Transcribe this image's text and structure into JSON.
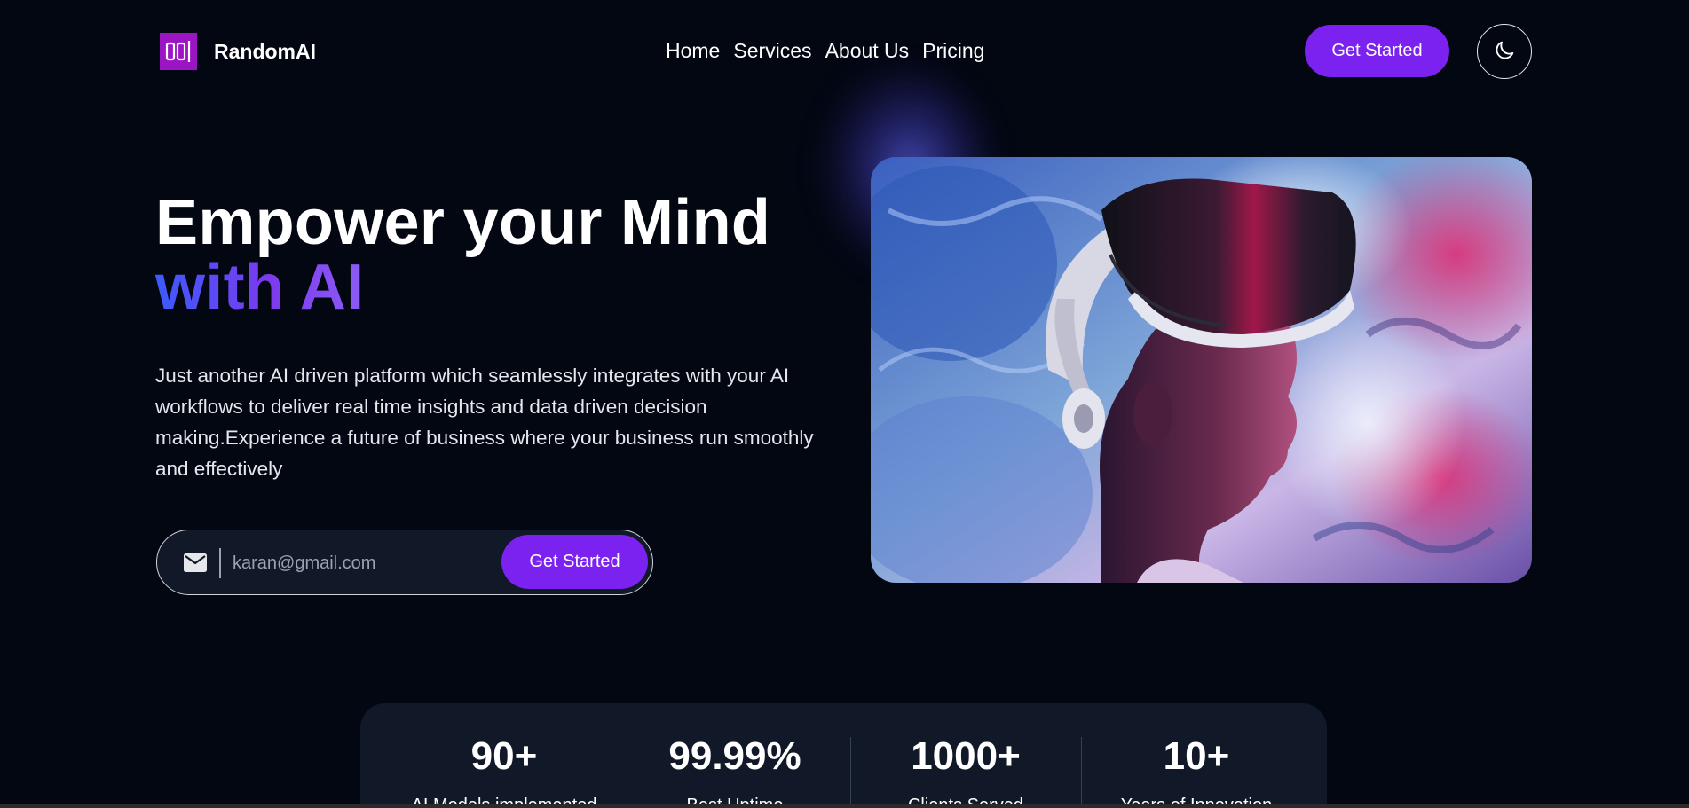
{
  "brand": {
    "name": "RandomAI",
    "logo_icon": "brackets-logo-icon",
    "logo_color": "#9b15c4"
  },
  "nav": {
    "items": [
      "Home",
      "Services",
      "About Us",
      "Pricing"
    ]
  },
  "header": {
    "cta_label": "Get Started",
    "theme_icon": "moon-icon"
  },
  "hero": {
    "title_line1": "Empower your Mind",
    "title_line2": "with AI",
    "description": "Just another AI driven platform which seamlessly integrates with your AI workflows to deliver real time insights and data driven decision making.Experience a future of business where your business run smoothly and effectively",
    "image_icon": "vr-headset-photo"
  },
  "email_form": {
    "icon": "mail-icon",
    "placeholder": "karan@gmail.com",
    "value": "",
    "cta_label": "Get Started"
  },
  "stats": [
    {
      "value": "90+",
      "label": "AI Models implemented"
    },
    {
      "value": "99.99%",
      "label": "Best Uptime"
    },
    {
      "value": "1000+",
      "label": "Clients Served"
    },
    {
      "value": "10+",
      "label": "Years of Innovation"
    }
  ],
  "colors": {
    "background": "#030712",
    "accent": "#7c22f0",
    "gradient_start": "#3b5bfd",
    "gradient_end": "#8b5cf6"
  }
}
